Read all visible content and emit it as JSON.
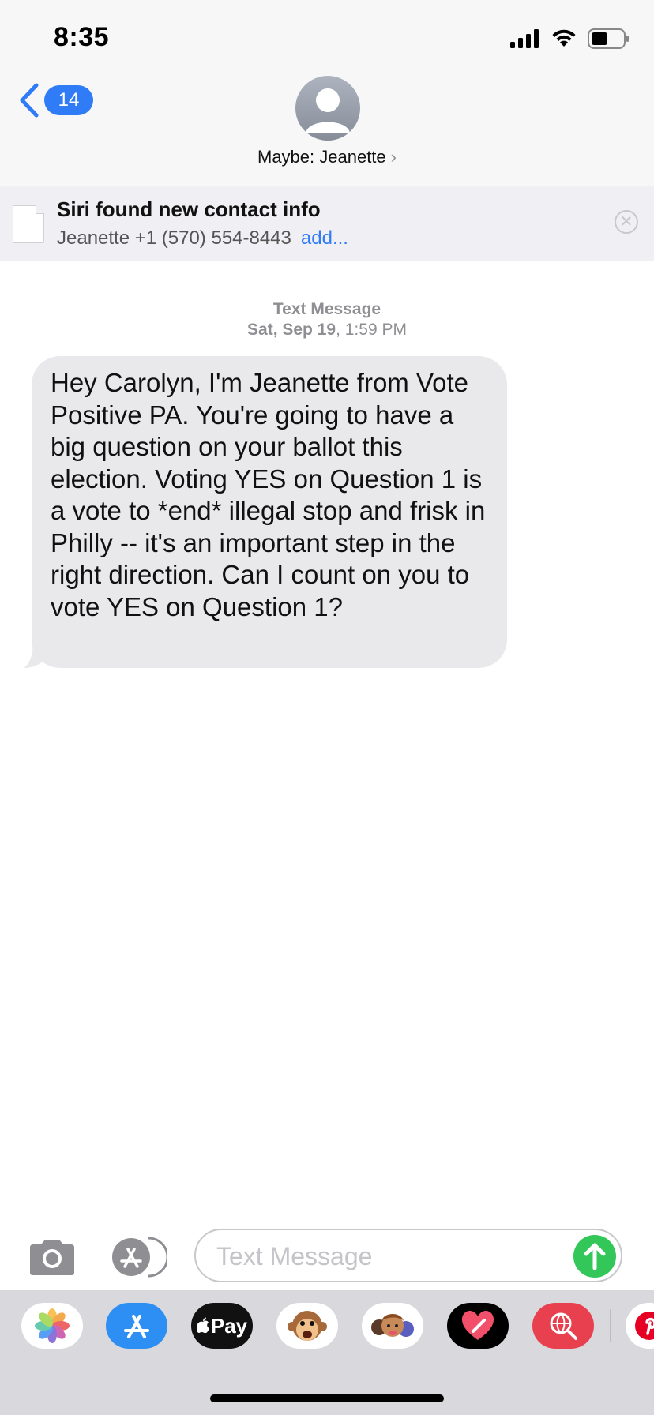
{
  "status_bar": {
    "time": "8:35"
  },
  "nav": {
    "back_count": "14",
    "contact_name": "Maybe: Jeanette",
    "chevron": "›"
  },
  "siri_banner": {
    "title": "Siri found new contact info",
    "contact_detail": "Jeanette +1 (570) 554-8443",
    "add_label": "add...",
    "close_glyph": "✕"
  },
  "thread": {
    "service_label": "Text Message",
    "date_day": "Sat, Sep 19",
    "date_time": ", 1:59 PM",
    "messages": [
      {
        "direction": "incoming",
        "text": "Hey Carolyn, I'm Jeanette from Vote Positive PA. You're going to have a big question on your ballot this election. Voting YES on Question 1 is a vote to *end* illegal stop and frisk in Philly -- it's an important step in the right direction. Can I count on you to vote YES on Question 1?"
      }
    ]
  },
  "compose": {
    "placeholder": "Text Message",
    "value": ""
  },
  "drawer": {
    "apps": [
      {
        "name": "photos",
        "icon": "photos-icon"
      },
      {
        "name": "app-store",
        "icon": "app-store-icon"
      },
      {
        "name": "apple-pay",
        "icon": "apple-pay-icon",
        "label": "Pay"
      },
      {
        "name": "animoji",
        "icon": "monkey-icon"
      },
      {
        "name": "memoji",
        "icon": "memoji-icon"
      },
      {
        "name": "digital-touch",
        "icon": "heart-icon"
      },
      {
        "name": "images-search",
        "icon": "globe-search-icon"
      },
      {
        "name": "pinterest",
        "icon": "pinterest-icon"
      }
    ]
  },
  "colors": {
    "accent_blue": "#2f7cf6",
    "send_green": "#33c759",
    "bubble_gray": "#e9e9eb",
    "header_bg": "#f7f7f8",
    "drawer_bg": "#d8d8dd"
  }
}
